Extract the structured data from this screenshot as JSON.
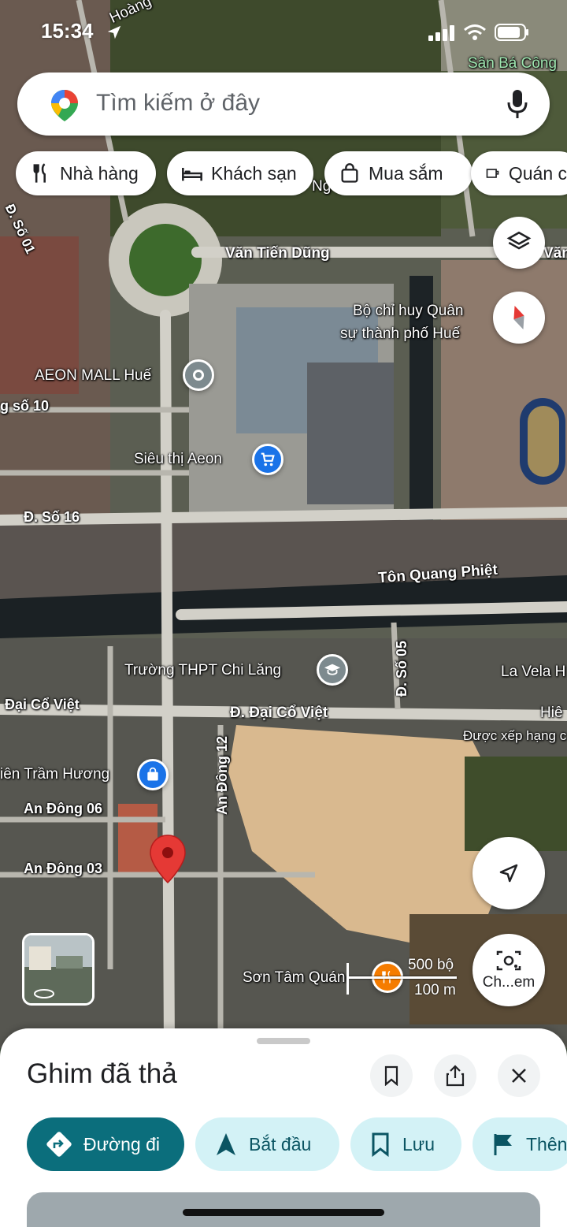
{
  "status_bar": {
    "time": "15:34"
  },
  "search": {
    "placeholder": "Tìm kiếm ở đây"
  },
  "chips": [
    {
      "label": "Nhà hàng",
      "icon": "restaurant-icon"
    },
    {
      "label": "Khách sạn",
      "icon": "hotel-icon"
    },
    {
      "label": "Mua sắm",
      "icon": "shopping-bag-icon"
    },
    {
      "label": "Quán c",
      "icon": "coffee-icon"
    }
  ],
  "map_labels": {
    "hoang": "Hoàng",
    "san_ba_cong": "Sân Bá Công",
    "van_tien_dung": "Văn Tiến Dũng",
    "van_right": "Văn",
    "bo_chi_huy_1": "Bộ chỉ huy Quân",
    "bo_chi_huy_2": "sự thành phố Huế",
    "aeon_mall": "AEON MALL Huế",
    "sieu_thi": "Siêu thị Aeon",
    "so_10": "g số 10",
    "so_16": "Đ. Số 16",
    "so_01": "Đ. Số 01",
    "ton_quang_phiet": "Tôn Quang Phiệt",
    "so_05": "Đ. Số 05",
    "truong_thpt": "Trường THPT Chi Lăng",
    "la_vela": "La Vela H",
    "dai_co_viet_left": "Đại Cổ Việt",
    "dai_co_viet": "Đ. Đại Cổ Việt",
    "hie": "Hiê",
    "duoc_xep_hang": "Được xếp hạng c",
    "tram_huong": "iên Trầm Hương",
    "an_dong_12": "An Đông 12",
    "an_dong_06": "An Đông 06",
    "an_dong_03": "An Đông 03",
    "son_tam_quan": "Sơn Tâm Quán",
    "nghia_partial": "Ng"
  },
  "scale": {
    "imperial": "500 bộ",
    "metric": "100 m"
  },
  "lens_button": {
    "label": "Ch...em"
  },
  "sheet": {
    "title": "Ghim đã thả",
    "buttons": [
      {
        "label": "Đường đi",
        "icon": "directions-icon"
      },
      {
        "label": "Bắt đầu",
        "icon": "navigation-arrow-icon"
      },
      {
        "label": "Lưu",
        "icon": "bookmark-icon"
      },
      {
        "label": "Thên",
        "icon": "flag-icon"
      }
    ]
  },
  "colors": {
    "primary": "#0b6e7c",
    "secondary_bg": "#d3f2f6",
    "pin_red": "#e53935",
    "poi_blue": "#1a73e8"
  }
}
